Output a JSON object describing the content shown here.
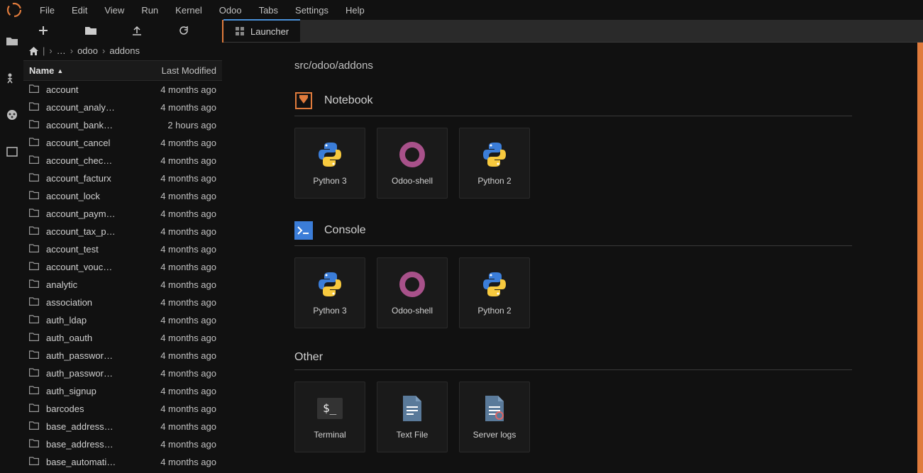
{
  "menu": [
    "File",
    "Edit",
    "View",
    "Run",
    "Kernel",
    "Odoo",
    "Tabs",
    "Settings",
    "Help"
  ],
  "breadcrumb": {
    "parts": [
      "…",
      "odoo",
      "addons"
    ]
  },
  "table": {
    "name_header": "Name",
    "modified_header": "Last Modified"
  },
  "files": [
    {
      "name": "account",
      "modified": "4 months ago"
    },
    {
      "name": "account_analy…",
      "modified": "4 months ago"
    },
    {
      "name": "account_bank…",
      "modified": "2 hours ago"
    },
    {
      "name": "account_cancel",
      "modified": "4 months ago"
    },
    {
      "name": "account_chec…",
      "modified": "4 months ago"
    },
    {
      "name": "account_facturx",
      "modified": "4 months ago"
    },
    {
      "name": "account_lock",
      "modified": "4 months ago"
    },
    {
      "name": "account_paym…",
      "modified": "4 months ago"
    },
    {
      "name": "account_tax_p…",
      "modified": "4 months ago"
    },
    {
      "name": "account_test",
      "modified": "4 months ago"
    },
    {
      "name": "account_vouc…",
      "modified": "4 months ago"
    },
    {
      "name": "analytic",
      "modified": "4 months ago"
    },
    {
      "name": "association",
      "modified": "4 months ago"
    },
    {
      "name": "auth_ldap",
      "modified": "4 months ago"
    },
    {
      "name": "auth_oauth",
      "modified": "4 months ago"
    },
    {
      "name": "auth_passwor…",
      "modified": "4 months ago"
    },
    {
      "name": "auth_passwor…",
      "modified": "4 months ago"
    },
    {
      "name": "auth_signup",
      "modified": "4 months ago"
    },
    {
      "name": "barcodes",
      "modified": "4 months ago"
    },
    {
      "name": "base_address…",
      "modified": "4 months ago"
    },
    {
      "name": "base_address…",
      "modified": "4 months ago"
    },
    {
      "name": "base_automati…",
      "modified": "4 months ago"
    }
  ],
  "tab": {
    "label": "Launcher"
  },
  "launcher": {
    "breadcrumb": "src/odoo/addons",
    "sections": {
      "notebook": {
        "label": "Notebook",
        "cards": [
          "Python 3",
          "Odoo-shell",
          "Python 2"
        ]
      },
      "console": {
        "label": "Console",
        "cards": [
          "Python 3",
          "Odoo-shell",
          "Python 2"
        ]
      },
      "other": {
        "label": "Other",
        "cards": [
          "Terminal",
          "Text File",
          "Server logs"
        ]
      }
    }
  }
}
